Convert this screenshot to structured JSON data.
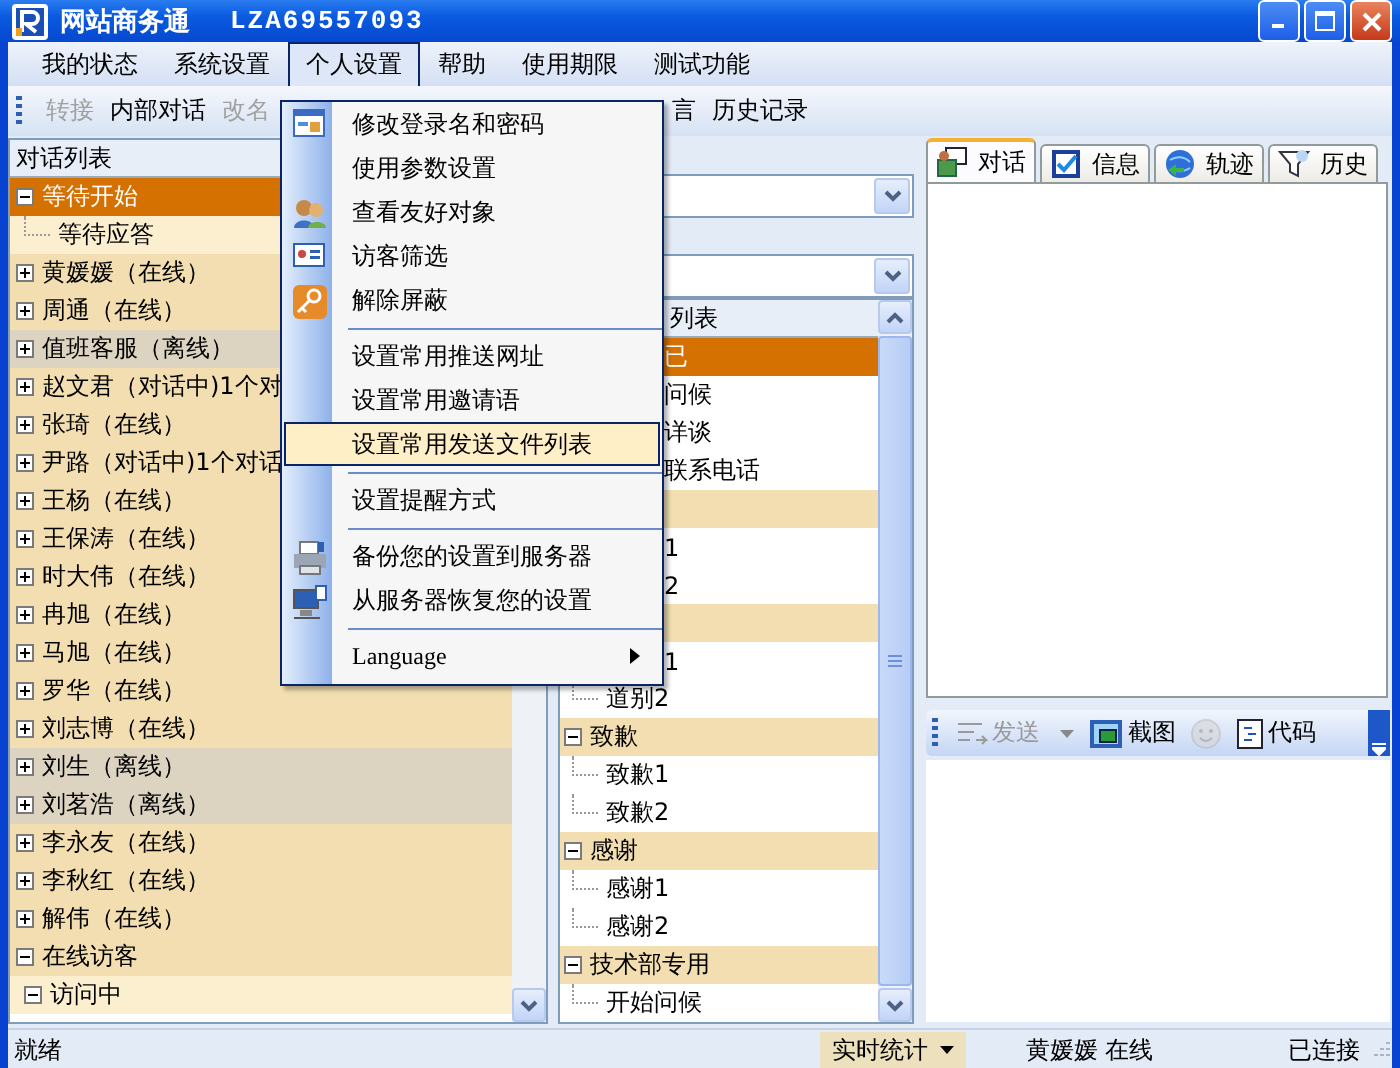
{
  "window": {
    "title": "网站商务通",
    "account": "LZA69557093"
  },
  "menu_bar": [
    {
      "label": "我的状态",
      "selected": false
    },
    {
      "label": "系统设置",
      "selected": false
    },
    {
      "label": "个人设置",
      "selected": true
    },
    {
      "label": "帮助",
      "selected": false
    },
    {
      "label": "使用期限",
      "selected": false
    },
    {
      "label": "测试功能",
      "selected": false
    }
  ],
  "toolbar": [
    {
      "label": "转接",
      "disabled": true
    },
    {
      "label": "内部对话",
      "disabled": false
    },
    {
      "label": "改名",
      "disabled": true
    },
    {
      "label": "言",
      "disabled": false,
      "clipped": true
    },
    {
      "label": "历史记录",
      "disabled": false
    }
  ],
  "personal_settings_menu": [
    {
      "kind": "item",
      "label": "修改登录名和密码",
      "selected": false,
      "submenu": false
    },
    {
      "kind": "item",
      "label": "使用参数设置",
      "selected": false,
      "submenu": false
    },
    {
      "kind": "item",
      "label": "查看友好对象",
      "selected": false,
      "submenu": false
    },
    {
      "kind": "item",
      "label": "访客筛选",
      "selected": false,
      "submenu": false
    },
    {
      "kind": "item",
      "label": "解除屏蔽",
      "selected": false,
      "submenu": false
    },
    {
      "kind": "separator"
    },
    {
      "kind": "item",
      "label": "设置常用推送网址",
      "selected": false,
      "submenu": false
    },
    {
      "kind": "item",
      "label": "设置常用邀请语",
      "selected": false,
      "submenu": false
    },
    {
      "kind": "item",
      "label": "设置常用发送文件列表",
      "selected": true,
      "submenu": false
    },
    {
      "kind": "separator"
    },
    {
      "kind": "item",
      "label": "设置提醒方式",
      "selected": false,
      "submenu": false
    },
    {
      "kind": "separator"
    },
    {
      "kind": "item",
      "label": "备份您的设置到服务器",
      "selected": false,
      "submenu": false
    },
    {
      "kind": "item",
      "label": "从服务器恢复您的设置",
      "selected": false,
      "submenu": false
    },
    {
      "kind": "separator"
    },
    {
      "kind": "item",
      "label": "Language",
      "selected": false,
      "submenu": true
    }
  ],
  "conversation_list": {
    "title": "对话列表",
    "nodes": [
      {
        "label": "等待开始",
        "expanded": true,
        "selected": true,
        "children": [
          {
            "label": "等待应答",
            "selected": false
          }
        ]
      },
      {
        "label": "黄媛媛（在线）",
        "expanded": false,
        "selected": false,
        "offline": false
      },
      {
        "label": "周通（在线）",
        "expanded": false,
        "selected": false,
        "offline": false
      },
      {
        "label": "值班客服（离线）",
        "expanded": false,
        "selected": false,
        "offline": true
      },
      {
        "label": "赵文君（对话中)1个对",
        "expanded": false,
        "selected": false,
        "offline": false
      },
      {
        "label": "张琦（在线）",
        "expanded": false,
        "selected": false,
        "offline": false
      },
      {
        "label": "尹路（对话中)1个对话",
        "expanded": false,
        "selected": false,
        "offline": false
      },
      {
        "label": "王杨（在线）",
        "expanded": false,
        "selected": false,
        "offline": false
      },
      {
        "label": "王保涛（在线）",
        "expanded": false,
        "selected": false,
        "offline": false
      },
      {
        "label": "时大伟（在线）",
        "expanded": false,
        "selected": false,
        "offline": false
      },
      {
        "label": "冉旭（在线）",
        "expanded": false,
        "selected": false,
        "offline": false
      },
      {
        "label": "马旭（在线）",
        "expanded": false,
        "selected": false,
        "offline": false
      },
      {
        "label": "罗华（在线）",
        "expanded": false,
        "selected": false,
        "offline": false
      },
      {
        "label": "刘志博（在线）",
        "expanded": false,
        "selected": false,
        "offline": false
      },
      {
        "label": "刘生（离线）",
        "expanded": false,
        "selected": false,
        "offline": true
      },
      {
        "label": "刘茗浩（离线）",
        "expanded": false,
        "selected": false,
        "offline": true
      },
      {
        "label": "李永友（在线）",
        "expanded": false,
        "selected": false,
        "offline": false
      },
      {
        "label": "李秋红（在线）",
        "expanded": false,
        "selected": false,
        "offline": false
      },
      {
        "label": "解伟（在线）",
        "expanded": false,
        "selected": false,
        "offline": false
      },
      {
        "label": "在线访客",
        "expanded": true,
        "selected": false,
        "offline": false,
        "children": [
          {
            "label": "访问中",
            "selected": false,
            "expanded": true
          }
        ]
      }
    ]
  },
  "phrase_list": {
    "title": "列表",
    "groups": [
      {
        "label": "已",
        "selected": true,
        "clipped": true,
        "children": [
          {
            "label": "问候",
            "clipped": true
          },
          {
            "label": "详谈",
            "clipped": true
          },
          {
            "label": "联系电话",
            "clipped": true
          }
        ]
      },
      {
        "selected": false,
        "clipped": true,
        "children": [
          {
            "label": "1",
            "clipped": true
          },
          {
            "label": "2",
            "clipped": true
          }
        ]
      },
      {
        "selected": false,
        "clipped": true,
        "children": [
          {
            "label": "1",
            "clipped": true
          },
          {
            "label": "道别2",
            "clipped": false
          }
        ]
      },
      {
        "label": "致歉",
        "selected": false,
        "clipped": false,
        "expanded": true,
        "children": [
          {
            "label": "致歉1",
            "clipped": false
          },
          {
            "label": "致歉2",
            "clipped": false
          }
        ]
      },
      {
        "label": "感谢",
        "selected": false,
        "clipped": false,
        "expanded": true,
        "children": [
          {
            "label": "感谢1",
            "clipped": false
          },
          {
            "label": "感谢2",
            "clipped": false
          }
        ]
      },
      {
        "label": "技术部专用",
        "selected": false,
        "clipped": false,
        "expanded": true,
        "children": [
          {
            "label": "开始问候",
            "clipped": false
          }
        ]
      }
    ]
  },
  "tabs": [
    {
      "label": "对话",
      "selected": true
    },
    {
      "label": "信息",
      "selected": false
    },
    {
      "label": "轨迹",
      "selected": false
    },
    {
      "label": "历史",
      "selected": false
    }
  ],
  "chat_toolbar": [
    {
      "kind": "button",
      "label": "发送",
      "disabled": true,
      "dropdown": true
    },
    {
      "kind": "button",
      "label": "截图",
      "disabled": false,
      "dropdown": false
    },
    {
      "kind": "icon",
      "disabled": true
    },
    {
      "kind": "button",
      "label": "代码",
      "disabled": false,
      "dropdown": false
    }
  ],
  "status_bar": {
    "text": "就绪",
    "stats_button": "实时统计",
    "contact": "黄媛媛  在线",
    "connection": "已连接"
  }
}
